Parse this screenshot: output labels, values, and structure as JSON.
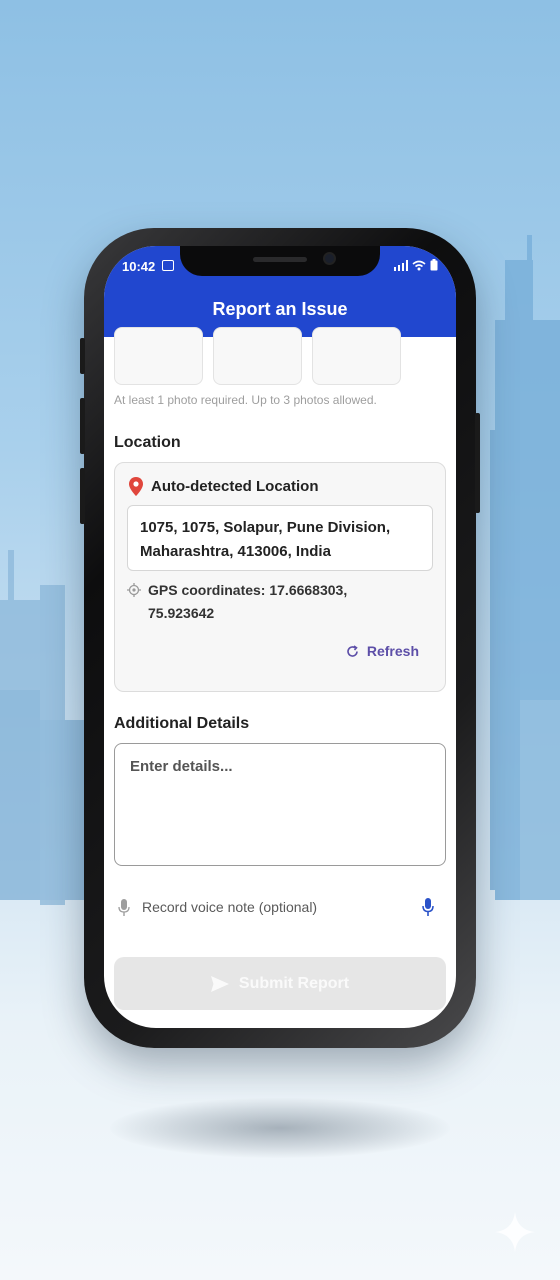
{
  "status_bar": {
    "time": "10:42"
  },
  "app_bar": {
    "title": "Report an Issue"
  },
  "photos": {
    "hint": "At least 1 photo required. Up to 3 photos allowed."
  },
  "location": {
    "section_title": "Location",
    "card_title": "Auto-detected Location",
    "address": "1075, 1075, Solapur, Pune Division, Maharashtra, 413006, India",
    "gps_text": "GPS coordinates: 17.6668303, 75.923642",
    "refresh_label": "Refresh"
  },
  "details": {
    "section_title": "Additional Details",
    "placeholder": "Enter details..."
  },
  "voice": {
    "label": "Record voice note (optional)"
  },
  "submit": {
    "label": "Submit Report"
  },
  "colors": {
    "app_bar": "#2147cf",
    "pin": "#e0463c",
    "refresh": "#5d4fa8",
    "mic_active": "#2a52c8",
    "submit_disabled": "#e6e6e6"
  }
}
